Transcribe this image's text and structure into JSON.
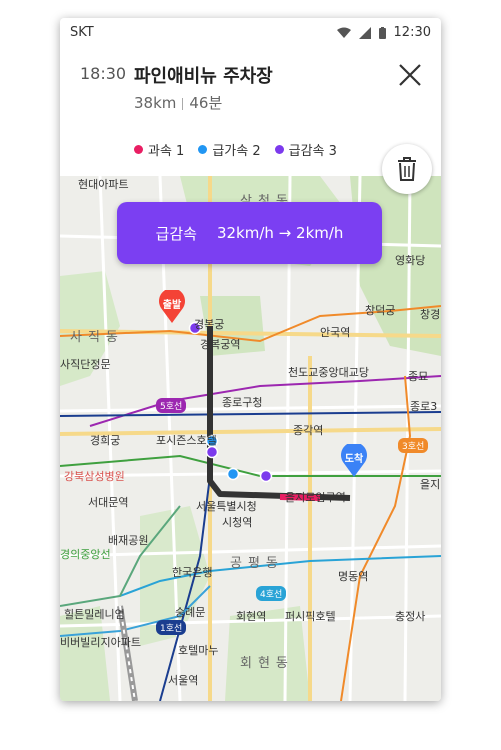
{
  "status_bar": {
    "carrier": "SKT",
    "time": "12:30"
  },
  "trip": {
    "eta": "18:30",
    "destination": "파인애비뉴 주차장",
    "distance": "38km",
    "duration": "46분",
    "close_icon": "close-icon"
  },
  "legend": [
    {
      "label": "과속 1",
      "color": "#e91e63"
    },
    {
      "label": "급가속 2",
      "color": "#2196f3"
    },
    {
      "label": "급감속 3",
      "color": "#7c3aed"
    }
  ],
  "banner": {
    "event": "급감속",
    "speed_change": "32km/h → 2km/h",
    "color": "#7b3ff2"
  },
  "markers": {
    "start": "출발",
    "end": "도착",
    "start_color": "#f44336",
    "end_color": "#3b82f6"
  },
  "map": {
    "districts": [
      "삼청동",
      "사직동",
      "공평동",
      "회현동"
    ],
    "places": [
      "현대아파트",
      "영화당",
      "창덕궁",
      "창경",
      "경복궁",
      "경복궁역",
      "안국역",
      "사직단정문",
      "천도교중앙대교당",
      "종묘",
      "종로구청",
      "종로3",
      "경희궁",
      "포시즌스호텔",
      "종각역",
      "강북삼성병원",
      "서대문역",
      "서울특별시청",
      "시청역",
      "을지로입구역",
      "을지",
      "배재공원",
      "한국은행",
      "명동역",
      "숭례문",
      "회현역",
      "퍼시픽호텔",
      "충정사",
      "서울역",
      "힐튼밀레니엄",
      "호텔마누",
      "비버빌리지아파트",
      "경의중앙선"
    ],
    "subway_lines": [
      "5호선",
      "3호선",
      "4호선",
      "1호선"
    ]
  }
}
